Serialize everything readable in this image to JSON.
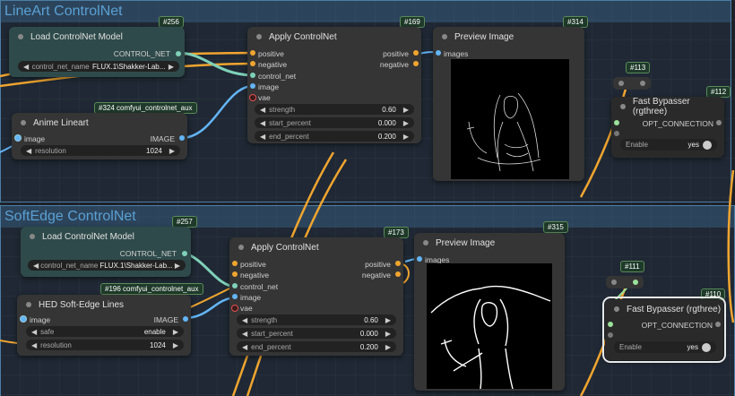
{
  "groups": [
    {
      "title": "LineArt ControlNet"
    },
    {
      "title": "SoftEdge ControlNet"
    }
  ],
  "nodes": {
    "lcm1": {
      "badge": "#256",
      "title": "Load ControlNet Model",
      "out": "CONTROL_NET",
      "w_label": "control_net_name",
      "w_value": "FLUX.1\\Shakker-Lab..."
    },
    "apply1": {
      "badge": "#169",
      "title": "Apply ControlNet",
      "in": [
        "positive",
        "negative",
        "control_net",
        "image",
        "vae"
      ],
      "out": [
        "positive",
        "negative"
      ],
      "w": [
        {
          "label": "strength",
          "value": "0.60"
        },
        {
          "label": "start_percent",
          "value": "0.000"
        },
        {
          "label": "end_percent",
          "value": "0.200"
        }
      ]
    },
    "preview1": {
      "badge": "#314",
      "title": "Preview Image",
      "in": "images"
    },
    "anime": {
      "badge": "#324 comfyui_controlnet_aux",
      "title": "Anime Lineart",
      "in": "image",
      "out": "IMAGE",
      "w_label": "resolution",
      "w_value": "1024"
    },
    "reroute1": {
      "badge": "#113"
    },
    "fb1": {
      "badge": "#112",
      "title": "Fast Bypasser (rgthree)",
      "out": "OPT_CONNECTION",
      "toggle_label": "Enable",
      "toggle_value": "yes"
    },
    "lcm2": {
      "badge": "#257",
      "title": "Load ControlNet Model",
      "out": "CONTROL_NET",
      "w_label": "control_net_name",
      "w_value": "FLUX.1\\Shakker-Lab..."
    },
    "apply2": {
      "badge": "#173",
      "title": "Apply ControlNet",
      "in": [
        "positive",
        "negative",
        "control_net",
        "image",
        "vae"
      ],
      "out": [
        "positive",
        "negative"
      ],
      "w": [
        {
          "label": "strength",
          "value": "0.60"
        },
        {
          "label": "start_percent",
          "value": "0.000"
        },
        {
          "label": "end_percent",
          "value": "0.200"
        }
      ]
    },
    "preview2": {
      "badge": "#315",
      "title": "Preview Image",
      "in": "images"
    },
    "hed": {
      "badge": "#196 comfyui_controlnet_aux",
      "title": "HED Soft-Edge Lines",
      "in": "image",
      "out": "IMAGE",
      "w": [
        {
          "label": "safe",
          "value": "enable"
        },
        {
          "label": "resolution",
          "value": "1024"
        }
      ]
    },
    "reroute2": {
      "badge": "#111"
    },
    "fb2": {
      "badge": "#110",
      "title": "Fast Bypasser (rgthree)",
      "out": "OPT_CONNECTION",
      "toggle_label": "Enable",
      "toggle_value": "yes"
    }
  },
  "colors": {
    "clip_wire": "#f0a530",
    "image_wire": "#64b5f6",
    "controlnet_wire": "#7fd1b9",
    "group_border": "#4d7ea6"
  },
  "icons": {
    "arrow_left": "◀",
    "arrow_right": "▶"
  }
}
